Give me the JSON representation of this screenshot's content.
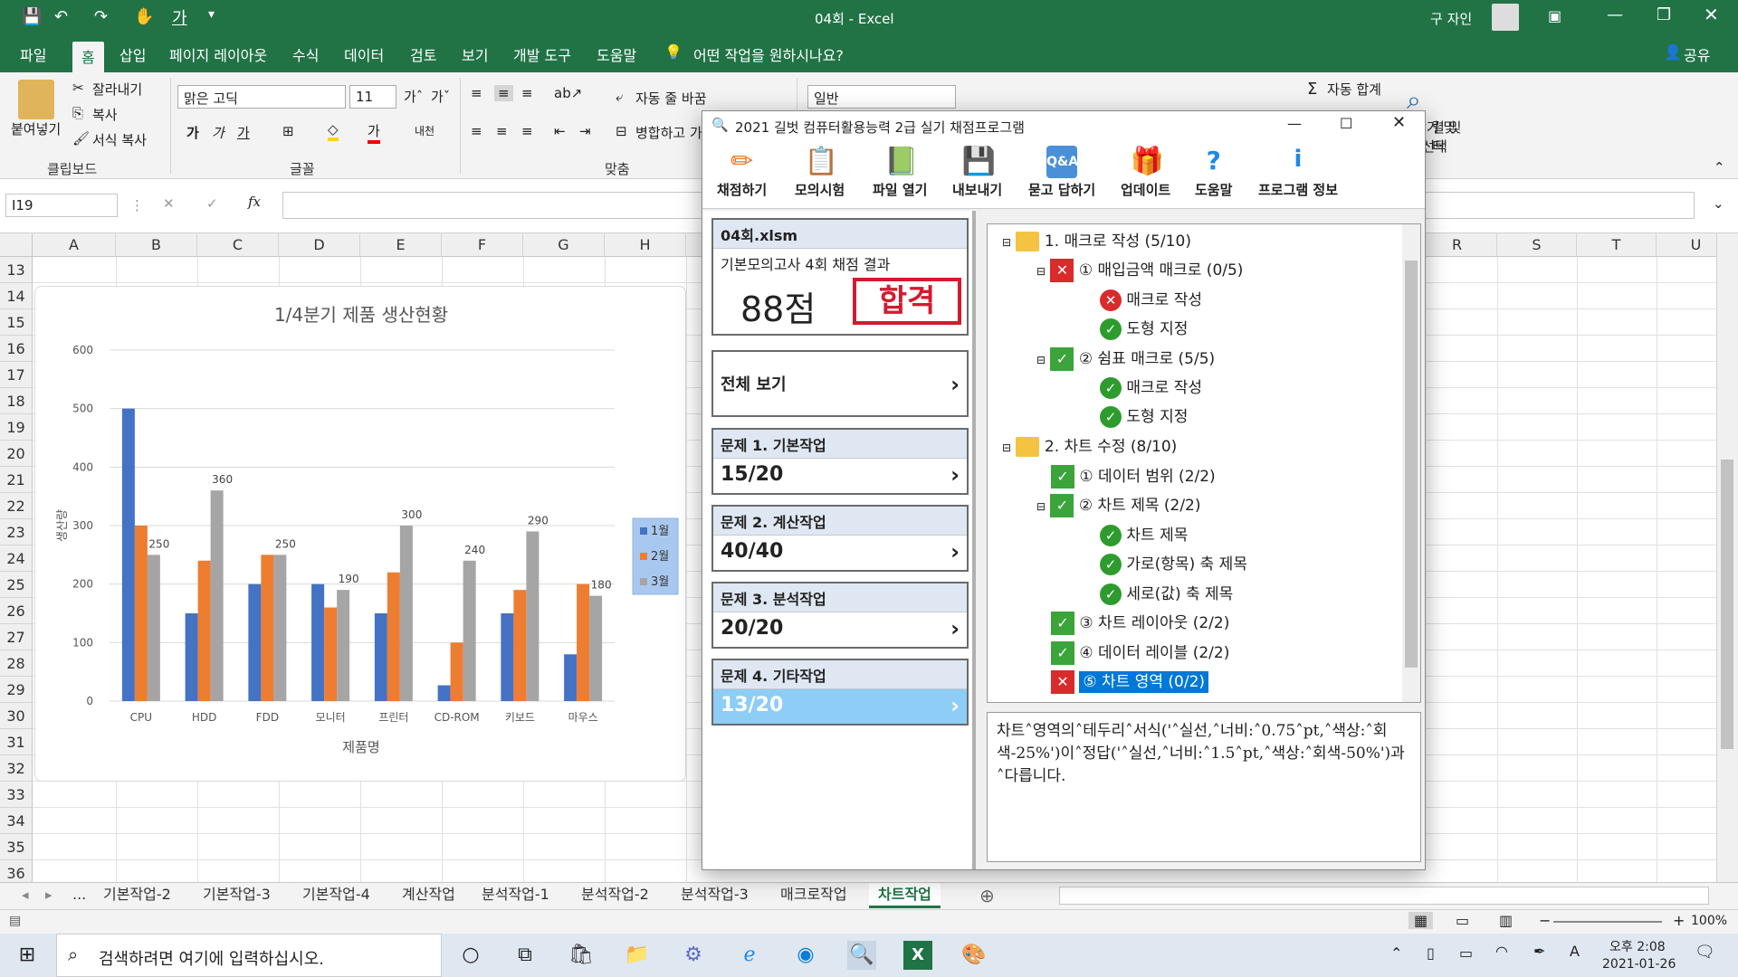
{
  "window": {
    "title": "04회 - Excel",
    "user": "구 자인"
  },
  "menu": [
    "파일",
    "홈",
    "삽입",
    "페이지 레이아웃",
    "수식",
    "데이터",
    "검토",
    "보기",
    "개발 도구",
    "도움말"
  ],
  "tell_me": "어떤 작업을 원하시나요?",
  "share": "공유",
  "ribbon": {
    "paste": "붙여넣기",
    "cut": "잘라내기",
    "copy": "복사",
    "format_painter": "서식 복사",
    "clipboard": "클립보드",
    "font_name": "맑은 고딕",
    "font_size": "11",
    "font_group": "글꼴",
    "wrap": "자동 줄 바꿈",
    "merge": "병합하고 가",
    "align_group": "맞춤",
    "number_format": "일반",
    "autosum": "자동 합계",
    "find_select": "찾기 및\n선택",
    "sort_filter": "렬 및\n터"
  },
  "namebox": "I19",
  "fx": "fx",
  "columns": [
    "A",
    "B",
    "C",
    "D",
    "E",
    "F",
    "G",
    "H",
    "R",
    "S",
    "T",
    "U"
  ],
  "rows": [
    "13",
    "14",
    "15",
    "16",
    "17",
    "18",
    "19",
    "20",
    "21",
    "22",
    "23",
    "24",
    "25",
    "26",
    "27",
    "28",
    "29",
    "30",
    "31",
    "32",
    "33",
    "34",
    "35",
    "36"
  ],
  "chart_data": {
    "type": "bar",
    "title": "1/4분기 제품 생산현황",
    "xlabel": "제품명",
    "ylabel": "생산량",
    "ylim": [
      0,
      600
    ],
    "yticks": [
      "0",
      "100",
      "200",
      "300",
      "400",
      "500",
      "600"
    ],
    "categories": [
      "CPU",
      "HDD",
      "FDD",
      "모니터",
      "프린터",
      "CD-ROM",
      "키보드",
      "마우스"
    ],
    "series": [
      {
        "name": "1월",
        "color": "#4472c4",
        "values": [
          500,
          150,
          200,
          200,
          150,
          27,
          150,
          80
        ]
      },
      {
        "name": "2월",
        "color": "#ed7d31",
        "values": [
          300,
          240,
          250,
          160,
          220,
          100,
          190,
          200
        ]
      },
      {
        "name": "3월",
        "color": "#a5a5a5",
        "values": [
          250,
          360,
          250,
          190,
          300,
          240,
          290,
          180
        ]
      }
    ],
    "data_labels_series": "3월",
    "legend": "right"
  },
  "sheet_tabs": [
    "...",
    "기본작업-2",
    "기본작업-3",
    "기본작업-4",
    "계산작업",
    "분석작업-1",
    "분석작업-2",
    "분석작업-3",
    "매크로작업",
    "차트작업"
  ],
  "active_tab": "차트작업",
  "zoom": "100%",
  "dialog": {
    "title": "2021 길벗 컴퓨터활용능력 2급 실기 채점프로그램",
    "toolbar": [
      "채점하기",
      "모의시험",
      "파일 열기",
      "내보내기",
      "묻고 답하기",
      "업데이트",
      "도움말",
      "프로그램 정보"
    ],
    "file": "04회.xlsm",
    "subtitle": "기본모의고사 4회 채점 결과",
    "score": "88점",
    "stamp": "합격",
    "view_all": "전체 보기",
    "sections": [
      {
        "label": "문제 1. 기본작업",
        "score": "15/20"
      },
      {
        "label": "문제 2. 계산작업",
        "score": "40/40"
      },
      {
        "label": "문제 3. 분석작업",
        "score": "20/20"
      },
      {
        "label": "문제 4. 기타작업",
        "score": "13/20"
      }
    ],
    "tree": [
      "1. 매크로 작성 (5/10)",
      "① 매입금액 매크로 (0/5)",
      "매크로 작성",
      "도형 지정",
      "② 쉼표 매크로 (5/5)",
      "매크로 작성",
      "도형 지정",
      "2. 차트 수정 (8/10)",
      "① 데이터 범위 (2/2)",
      "② 차트 제목 (2/2)",
      "차트 제목",
      "가로(항목) 축 제목",
      "세로(값) 축 제목",
      "③ 차트 레이아웃 (2/2)",
      "④ 데이터 레이블 (2/2)",
      "⑤ 차트 영역 (0/2)"
    ],
    "detail": "차트˄영역의˄테두리˄서식('˄실선,˄너비:˄0.75˄pt,˄색상:˄회색-25%')이˄정답('˄실선,˄너비:˄1.5˄pt,˄색상:˄회색-50%')과˄다릅니다."
  },
  "taskbar": {
    "search": "검색하려면 여기에 입력하십시오.",
    "time": "오후 2:08",
    "date": "2021-01-26"
  }
}
